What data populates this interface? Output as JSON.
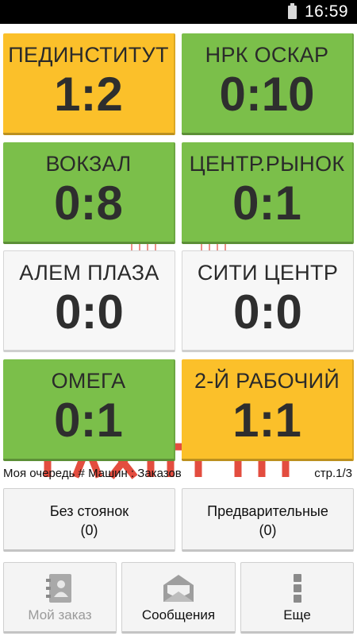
{
  "status_bar": {
    "time": "16:59"
  },
  "tiles": [
    {
      "name": "ПЕДИНСТИТУТ",
      "score": "1:2",
      "color": "#fbc02a"
    },
    {
      "name": "НРК ОСКАР",
      "score": "0:10",
      "color": "#7bbf4a"
    },
    {
      "name": "ВОКЗАЛ",
      "score": "0:8",
      "color": "#7bbf4a"
    },
    {
      "name": "ЦЕНТР.РЫНОК",
      "score": "0:1",
      "color": "#7bbf4a"
    },
    {
      "name": "АЛЕМ ПЛАЗА",
      "score": "0:0",
      "color": "#f7f7f7"
    },
    {
      "name": "СИТИ ЦЕНТР",
      "score": "0:0",
      "color": "#f7f7f7"
    },
    {
      "name": "ОМЕГА",
      "score": "0:1",
      "color": "#7bbf4a"
    },
    {
      "name": "2-Й РАБОЧИЙ",
      "score": "1:1",
      "color": "#fbc02a"
    }
  ],
  "queue_line": "Моя очередь # Машин : Заказов",
  "page_indicator": "стр.1/3",
  "middle_buttons": [
    {
      "label": "Без стоянок",
      "count": "(0)"
    },
    {
      "label": "Предварительные",
      "count": "(0)"
    }
  ],
  "bottom_buttons": [
    {
      "label": "Мой заказ",
      "icon": "contact-book-icon",
      "enabled": false
    },
    {
      "label": "Сообщения",
      "icon": "envelope-icon",
      "enabled": true
    },
    {
      "label": "Еще",
      "icon": "more-vertical-icon",
      "enabled": true
    }
  ]
}
